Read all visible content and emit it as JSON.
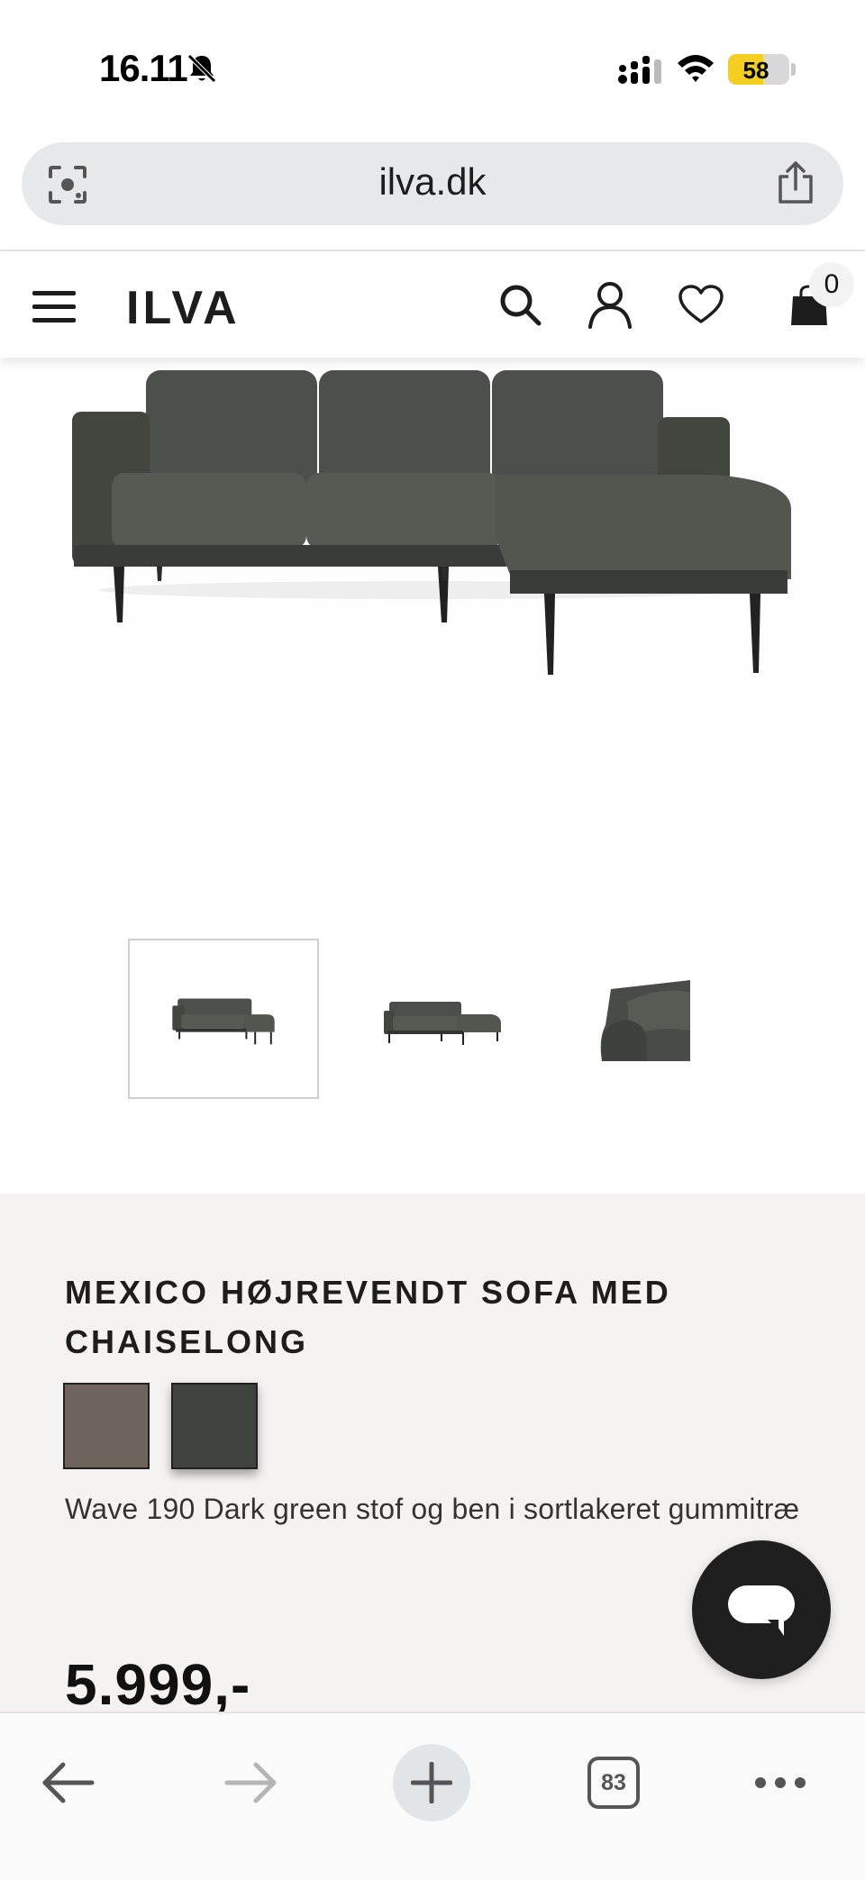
{
  "status_bar": {
    "time": "16.11",
    "battery": "58"
  },
  "browser": {
    "url": "ilva.dk",
    "tab_count": "83"
  },
  "site": {
    "logo_text": "ILVA",
    "cart_count": "0"
  },
  "product": {
    "brand": "MEXICO",
    "name": " HØJREVENDT SOFA MED CHAISELONG",
    "material": "Wave 190 Dark green stof og ben i sortlakeret gummitræ",
    "price": "5.999,-",
    "swatches": [
      {
        "color": "#6e645c",
        "selected": false
      },
      {
        "color": "#3e433d",
        "selected": true
      }
    ],
    "thumbnails": [
      {
        "selected": true
      },
      {
        "selected": false
      },
      {
        "selected": false
      }
    ]
  },
  "colors": {
    "sofa": "#464a44",
    "panel_bg": "#f4f3f1",
    "battery_accent": "#f5cf1f",
    "chat_button": "#1f1f1f"
  },
  "icons": [
    "bell-slash-icon",
    "signal-icon",
    "wifi-icon",
    "battery-icon",
    "lens-icon",
    "share-icon",
    "menu-icon",
    "search-icon",
    "user-icon",
    "heart-icon",
    "bag-icon",
    "chat-icon",
    "back-arrow-icon",
    "forward-arrow-icon",
    "plus-icon",
    "more-icon"
  ]
}
